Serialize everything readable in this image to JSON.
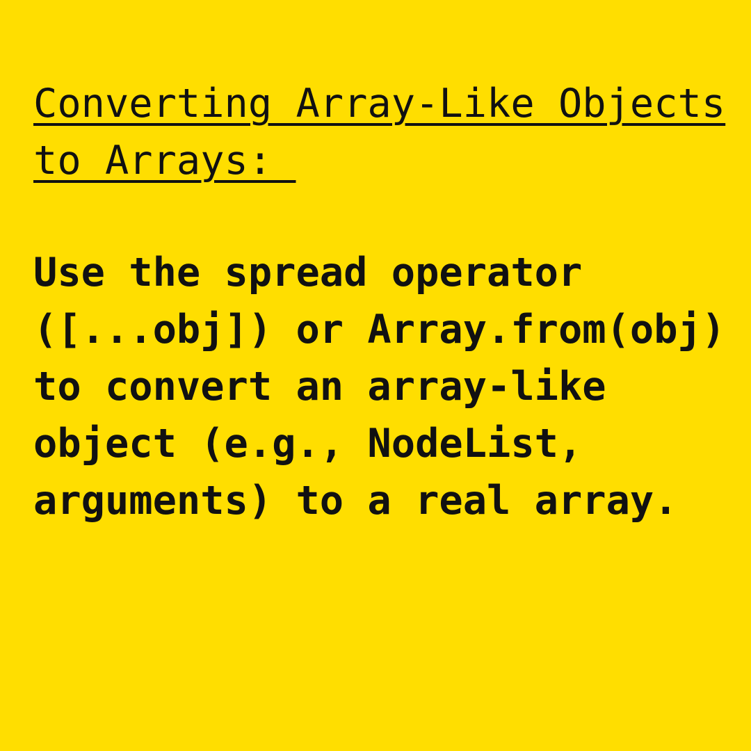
{
  "colors": {
    "background": "#FFDE00",
    "text": "#111111"
  },
  "heading": {
    "lines": [
      "Converting Array-Like Objects",
      "to Arrays: "
    ]
  },
  "body": {
    "lines": [
      "Use the spread operator",
      "([...obj]) or Array.from(obj)",
      "to convert an array-like",
      "object (e.g., NodeList,",
      "arguments) to a real array."
    ]
  }
}
